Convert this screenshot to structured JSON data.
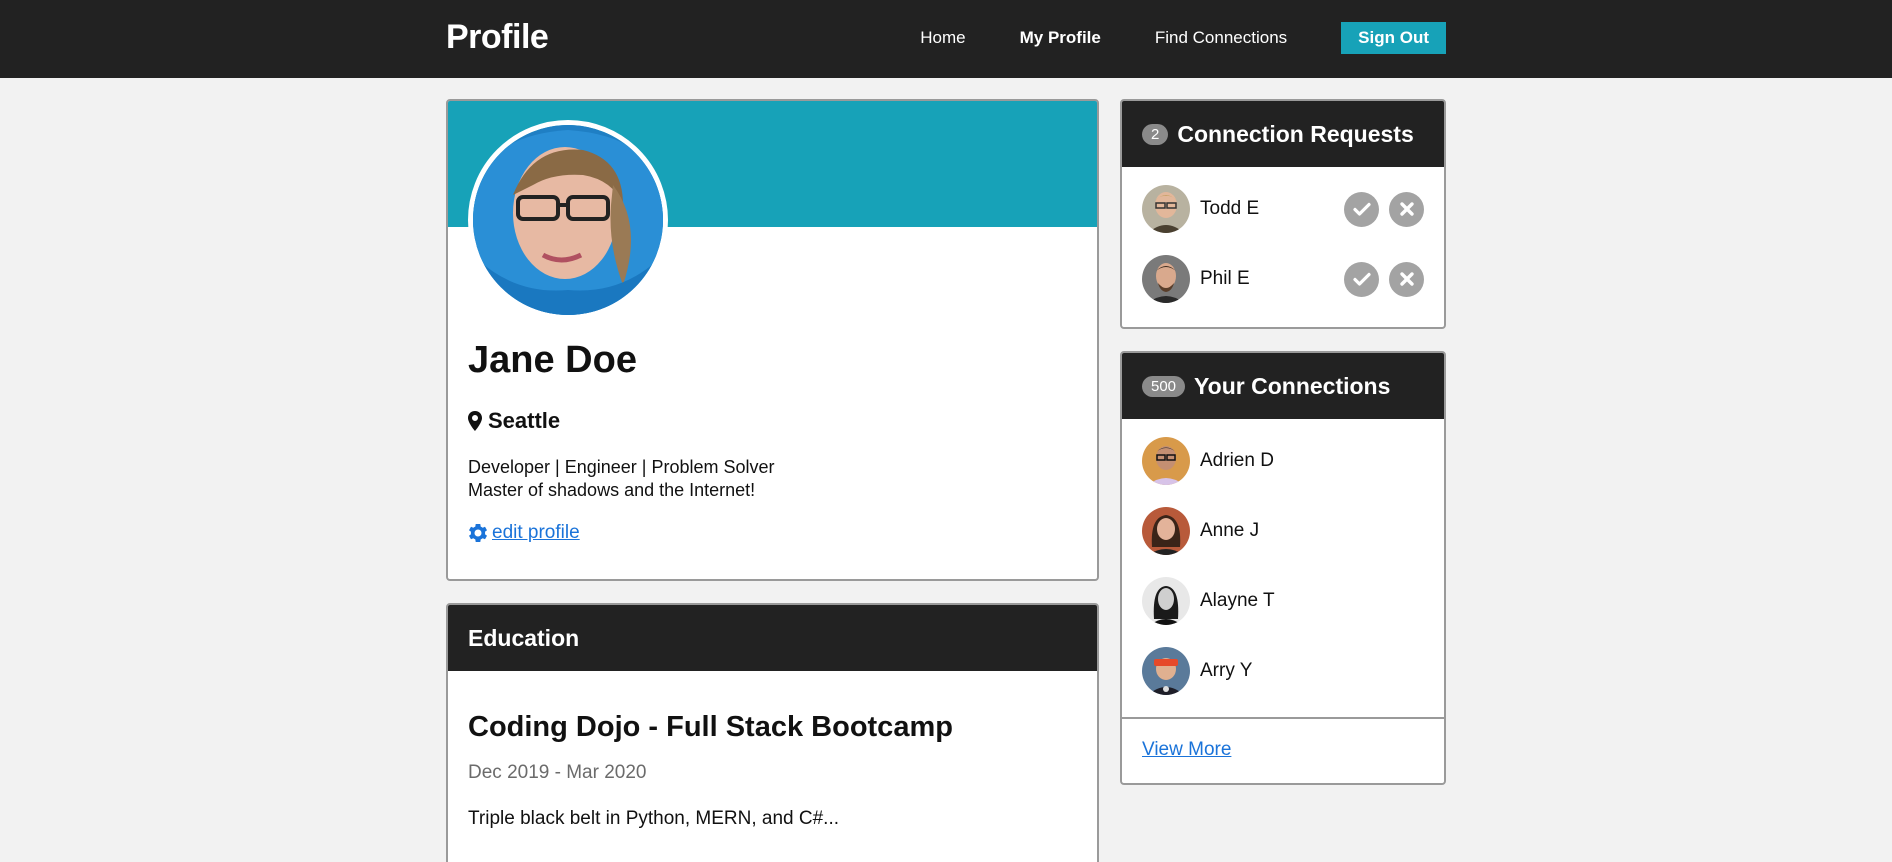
{
  "header": {
    "brand": "Profile",
    "nav": {
      "home": "Home",
      "my_profile": "My Profile",
      "find_connections": "Find Connections",
      "sign_out": "Sign Out"
    }
  },
  "profile": {
    "name": "Jane Doe",
    "location": "Seattle",
    "bio_line1": "Developer | Engineer | Problem Solver",
    "bio_line2": "Master of shadows and the Internet!",
    "edit_label": " edit profile",
    "banner_color": "#17a2b8"
  },
  "education": {
    "heading": "Education",
    "school": "Coding Dojo - Full Stack Bootcamp",
    "dates": "Dec 2019 - Mar 2020",
    "description": "Triple black belt in Python, MERN, and C#..."
  },
  "requests": {
    "count": "2",
    "heading": "Connection Requests",
    "people": [
      {
        "name": "Todd E"
      },
      {
        "name": "Phil E"
      }
    ]
  },
  "connections": {
    "count": "500",
    "heading": "Your Connections",
    "people": [
      {
        "name": "Adrien D"
      },
      {
        "name": "Anne J"
      },
      {
        "name": "Alayne T"
      },
      {
        "name": "Arry Y"
      }
    ],
    "view_more": "View More"
  },
  "icons": {
    "location": "map-marker-icon",
    "edit": "gear-icon",
    "accept": "check-icon",
    "decline": "close-icon"
  },
  "colors": {
    "accent": "#17a2b8",
    "header_bg": "#222222",
    "link": "#1a73d9"
  }
}
